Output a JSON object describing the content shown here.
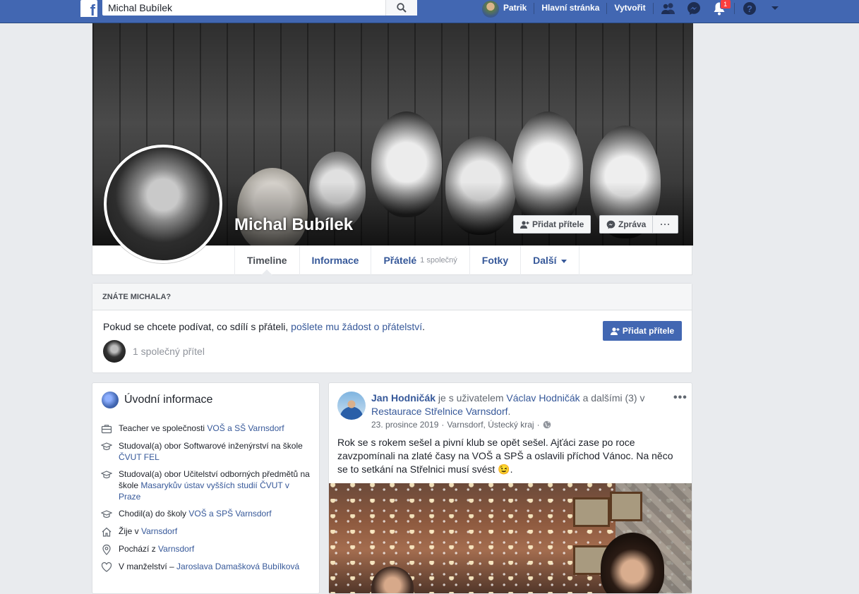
{
  "topbar": {
    "logo_letter": "f",
    "search_value": "Michal Bubílek",
    "search_icon": "search-icon",
    "user_name": "Patrik",
    "home_label": "Hlavní stránka",
    "create_label": "Vytvořit",
    "notifications_count": "1",
    "icons": [
      "friend-requests-icon",
      "messenger-icon",
      "notifications-icon",
      "help-icon",
      "account-menu-caret-icon"
    ]
  },
  "profile": {
    "name": "Michal Bubílek",
    "add_friend_label": "Přidat přítele",
    "message_label": "Zpráva",
    "more_label": "···",
    "tabs": [
      {
        "label": "Timeline",
        "sub": ""
      },
      {
        "label": "Informace",
        "sub": ""
      },
      {
        "label": "Přátelé",
        "sub": "1 společný"
      },
      {
        "label": "Fotky",
        "sub": ""
      },
      {
        "label": "Další",
        "sub": ""
      }
    ]
  },
  "know": {
    "heading": "ZNÁTE MICHALA?",
    "text_prefix": "Pokud se chcete podívat, co sdílí s přáteli, ",
    "text_link": "pošlete mu žádost o přátelství",
    "text_suffix": ".",
    "mutual": "1 společný přítel",
    "add_friend_label": "Přidat přítele"
  },
  "intro": {
    "title": "Úvodní informace",
    "items": [
      {
        "icon": "briefcase-icon",
        "text": "Teacher ve společnosti ",
        "link": "VOŠ a SŠ Varnsdorf",
        "after": ""
      },
      {
        "icon": "graduation-cap-icon",
        "text": "Studoval(a) obor Softwarové inženýrství na škole ",
        "link": "ČVUT FEL",
        "after": ""
      },
      {
        "icon": "graduation-cap-icon",
        "text": "Studoval(a) obor Učitelství odborných předmětů na škole ",
        "link": "Masarykův ústav vyšších studií ČVUT v Praze",
        "after": ""
      },
      {
        "icon": "graduation-cap-icon",
        "text": "Chodil(a) do školy ",
        "link": "VOŠ a SPŠ Varnsdorf",
        "after": ""
      },
      {
        "icon": "home-icon",
        "text": "Žije v ",
        "link": "Varnsdorf",
        "after": ""
      },
      {
        "icon": "location-pin-icon",
        "text": "Pochází z ",
        "link": "Varnsdorf",
        "after": ""
      },
      {
        "icon": "heart-icon",
        "text": "V manželství – ",
        "link": "Jaroslava Damašková Bubílková",
        "after": ""
      }
    ]
  },
  "post": {
    "author": "Jan Hodničák",
    "with_text": " je s uživatelem ",
    "with_person": "Václav Hodničák",
    "and_others": " a dalšími (3)",
    "at_text": " v ",
    "place": "Restaurace Střelnice Varnsdorf",
    "place_end": ".",
    "date": "23. prosince 2019",
    "location": "Varnsdorf, Ústecký kraj",
    "privacy_icon": "globe-icon",
    "body": "Rok se s rokem sešel a pivní klub se opět sešel. Ajťáci zase po roce zavzpomínali na zlaté časy na VOŠ a SPŠ a oslavili příchod Vánoc. Na něco se to setkání na Střelnici musí svést 😉.",
    "more_label": "•••"
  },
  "colors": {
    "brand": "#4267b2",
    "page_bg": "#e9ebee",
    "link": "#365899",
    "badge": "#fa3e3e"
  }
}
